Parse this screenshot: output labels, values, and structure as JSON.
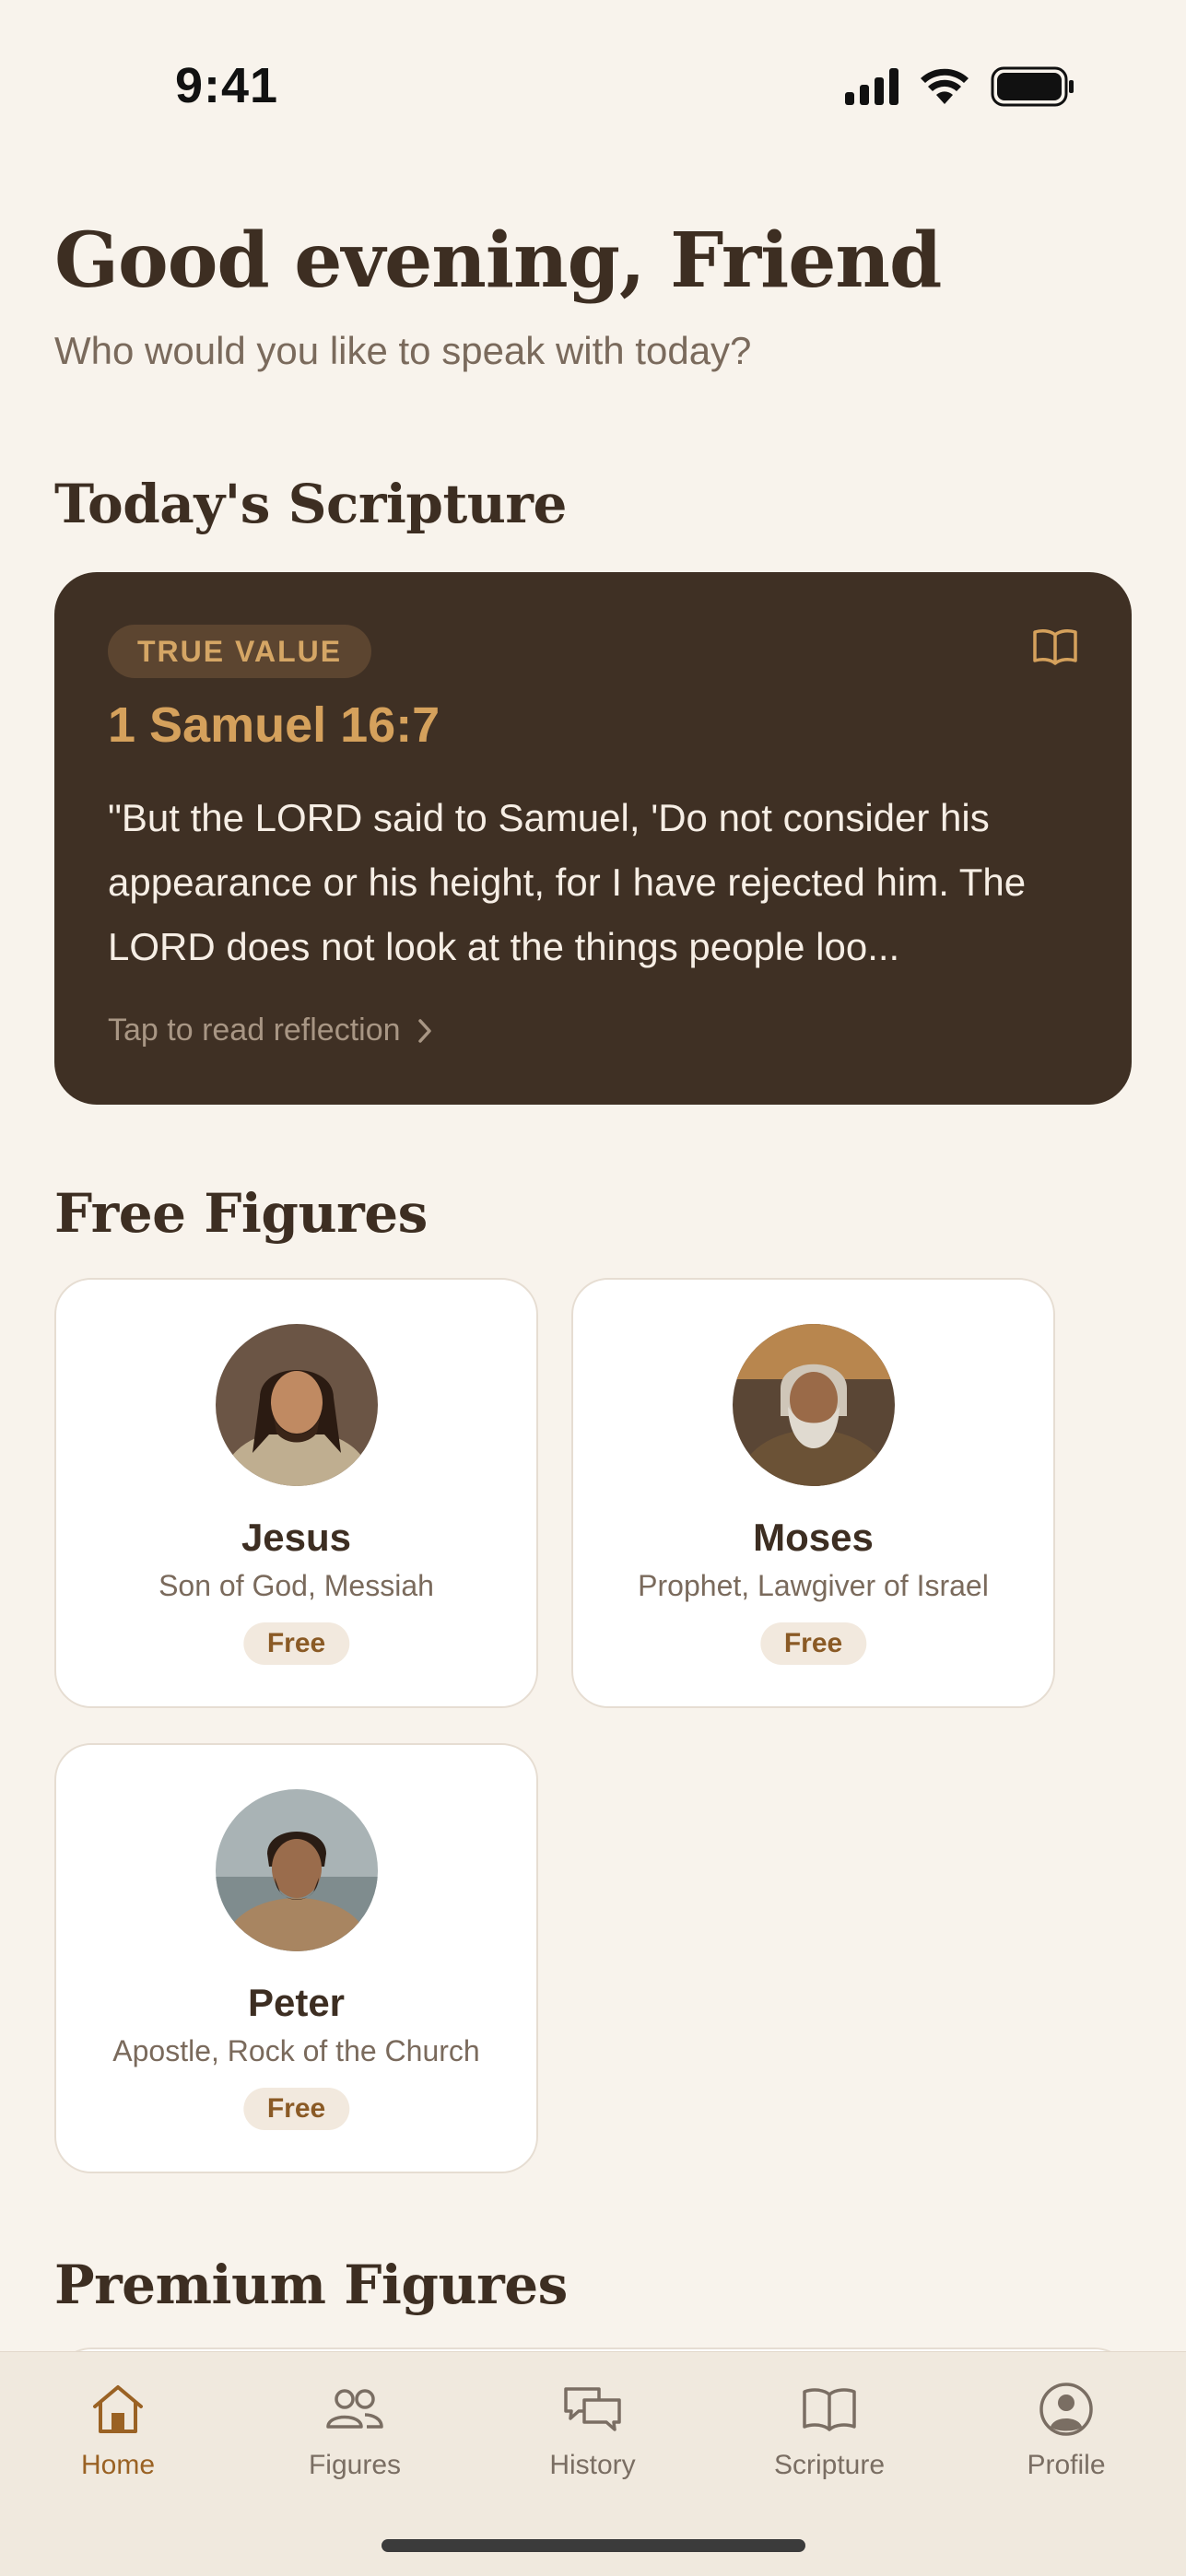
{
  "status_bar": {
    "time": "9:41"
  },
  "header": {
    "greeting": "Good evening, Friend",
    "subtitle": "Who would you like to speak with today?"
  },
  "scripture": {
    "section_title": "Today's Scripture",
    "badge": "TRUE VALUE",
    "reference": "1 Samuel 16:7",
    "text": "\"But the LORD said to Samuel, 'Do not consider his appearance or his height, for I have rejected him. The LORD does not look at the things people loo...",
    "link": "Tap to read reflection",
    "icon": "open-book-icon"
  },
  "free_figures": {
    "section_title": "Free Figures",
    "items": [
      {
        "name": "Jesus",
        "role": "Son of God, Messiah",
        "badge": "Free"
      },
      {
        "name": "Moses",
        "role": "Prophet, Lawgiver of Israel",
        "badge": "Free"
      },
      {
        "name": "Peter",
        "role": "Apostle, Rock of the Church",
        "badge": "Free"
      }
    ]
  },
  "premium_figures": {
    "section_title": "Premium Figures"
  },
  "tab_bar": {
    "tabs": [
      {
        "label": "Home",
        "icon": "home-icon",
        "active": true
      },
      {
        "label": "Figures",
        "icon": "people-icon",
        "active": false
      },
      {
        "label": "History",
        "icon": "chat-bubbles-icon",
        "active": false
      },
      {
        "label": "Scripture",
        "icon": "book-icon",
        "active": false
      },
      {
        "label": "Profile",
        "icon": "profile-icon",
        "active": false
      }
    ]
  },
  "colors": {
    "background": "#f8f3ec",
    "card_dark": "#3f3024",
    "accent_gold": "#d5a15c",
    "text_dark": "#3d2e22",
    "active_tab": "#9a6224"
  }
}
